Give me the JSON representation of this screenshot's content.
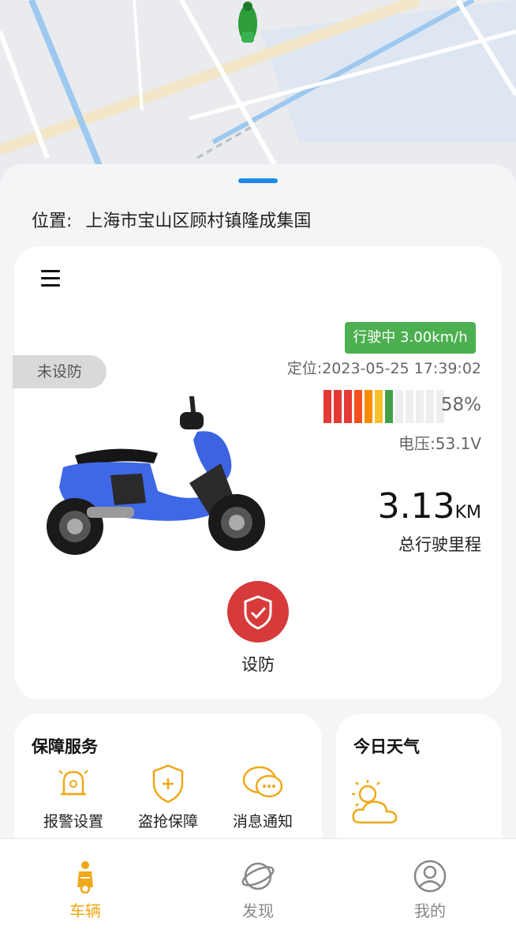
{
  "location": {
    "label": "位置:",
    "address": "上海市宝山区顾村镇隆成集国"
  },
  "vehicle": {
    "arm_status": "未设防",
    "driving_badge": "行驶中 3.00km/h",
    "position_time": "定位:2023-05-25 17:39:02",
    "battery": {
      "percent_text": "58%",
      "percent_value": 58,
      "segment_colors": [
        "#e53935",
        "#e53935",
        "#e53935",
        "#f4511e",
        "#fb8c00",
        "#fbc02d",
        "#43a047",
        "#eeeeee",
        "#eeeeee",
        "#eeeeee",
        "#eeeeee",
        "#eeeeee"
      ]
    },
    "voltage": "电压:53.1V",
    "mileage_value": "3.13",
    "mileage_unit": "KM",
    "mileage_label": "总行驶里程",
    "arm_button_label": "设防"
  },
  "services": {
    "title": "保障服务",
    "items": [
      {
        "label": "报警设置",
        "icon": "alarm-bell-icon"
      },
      {
        "label": "盗抢保障",
        "icon": "shield-plus-icon"
      },
      {
        "label": "消息通知",
        "icon": "chat-bubble-icon"
      }
    ]
  },
  "weather": {
    "title": "今日天气",
    "icon": "partly-cloudy-icon"
  },
  "tabbar": {
    "active": "车辆",
    "tabs": [
      {
        "label": "车辆",
        "icon": "scooter-icon"
      },
      {
        "label": "发现",
        "icon": "planet-icon"
      },
      {
        "label": "我的",
        "icon": "user-icon"
      }
    ]
  },
  "colors": {
    "accent": "#f0a818",
    "driving_green": "#4caf50",
    "arm_red": "#d63a3a",
    "handle_blue": "#1e88e5"
  }
}
